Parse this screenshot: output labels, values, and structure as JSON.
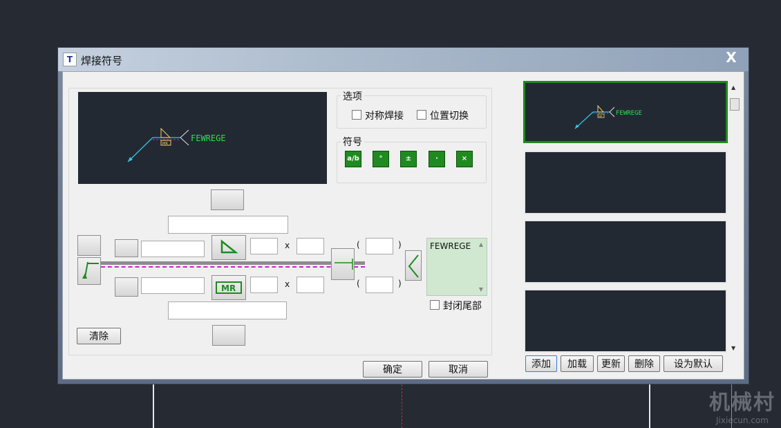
{
  "dialog": {
    "title": "焊接符号",
    "close_label": "X"
  },
  "preview": {
    "label_text": "FEWREGE",
    "tag_text": "MR"
  },
  "options": {
    "group_label": "选项",
    "symmetric_label": "对称焊接",
    "swap_label": "位置切换"
  },
  "symbols": {
    "group_label": "符号",
    "buttons": [
      {
        "label": "a/b",
        "icon": "fraction-icon"
      },
      {
        "label": "°",
        "icon": "degree-icon"
      },
      {
        "label": "±",
        "icon": "plus-minus-icon"
      },
      {
        "label": "·",
        "icon": "dot-icon"
      },
      {
        "label": "×",
        "icon": "times-icon"
      }
    ]
  },
  "editor": {
    "x_label": "x",
    "open_paren": "(",
    "close_paren": ")",
    "tail_text": "FEWREGE",
    "tag_text": "MR",
    "close_tail_label": "封闭尾部",
    "clear_label": "清除"
  },
  "footer": {
    "ok_label": "确定",
    "cancel_label": "取消"
  },
  "library": {
    "preview_text": "FEWREGE",
    "preview_tag": "MR",
    "add_label": "添加",
    "load_label": "加载",
    "update_label": "更新",
    "delete_label": "删除",
    "default_label": "设为默认"
  },
  "watermark": {
    "big": "机械村",
    "small": "Jixiecun.com"
  },
  "colors": {
    "canvas": "#232933",
    "accent_green": "#1f8a1f",
    "leader_cyan": "#37c4e0",
    "label_green": "#2fe04a",
    "magenta": "#d61ad6"
  }
}
